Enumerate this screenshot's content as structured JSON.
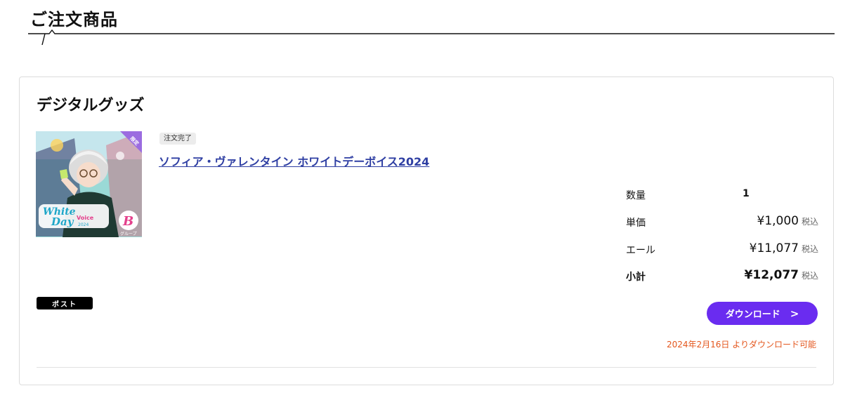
{
  "section": {
    "title": "ご注文商品"
  },
  "card": {
    "heading": "デジタルグッズ",
    "item": {
      "status": "注文完了",
      "title": "ソフィア・ヴァレンタイン ホワイトデーボイス2024",
      "thumbnail": {
        "logo_line1": "White",
        "logo_line2": "Day",
        "logo_line3": "Voice",
        "logo_year": "2024",
        "corner_badge": "限定",
        "group_letter": "B",
        "group_label": "グループ"
      }
    },
    "summary": {
      "quantity": {
        "label": "数量",
        "value": "1"
      },
      "unit_price": {
        "label": "単価",
        "value": "¥1,000",
        "tax": "税込"
      },
      "yell": {
        "label": "エール",
        "value": "¥11,077",
        "tax": "税込"
      },
      "subtotal": {
        "label": "小計",
        "value": "¥12,077",
        "tax": "税込"
      }
    },
    "post_button_label": "ポスト",
    "download": {
      "label": "ダウンロード",
      "chevron": ">",
      "note": "2024年2月16日 よりダウンロード可能"
    }
  },
  "colors": {
    "accent": "#6a2cf0",
    "link": "#2f3fa3",
    "note": "#e4571e"
  }
}
